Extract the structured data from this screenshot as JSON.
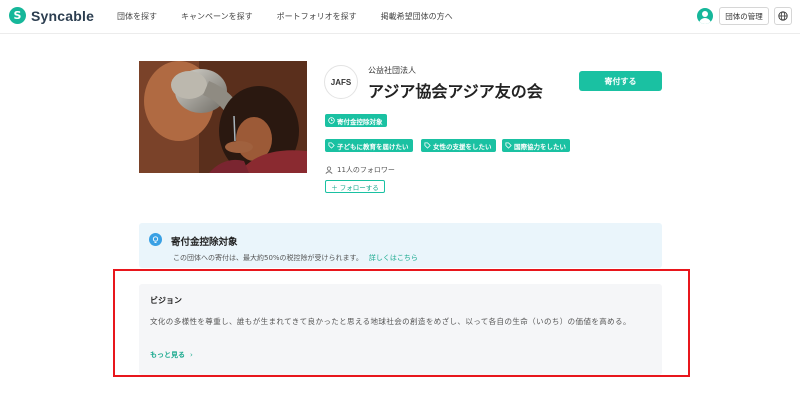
{
  "header": {
    "logo_text": "Syncable",
    "logo_mark": "S",
    "nav": [
      "団体を探す",
      "キャンペーンを探す",
      "ポートフォリオを探す",
      "掲載希望団体の方へ"
    ],
    "manage_label": "団体の管理",
    "brand_color": "#16b79a"
  },
  "org": {
    "type": "公益社団法人",
    "name": "アジア協会アジア友の会",
    "logo_text": "JAFS",
    "donate_label": "寄付する",
    "badge": "寄付金控除対象",
    "tags": [
      "子どもに教育を届けたい",
      "女性の支援をしたい",
      "国際協力をしたい"
    ],
    "followers": "11人のフォロワー",
    "follow_label": "＋ フォローする"
  },
  "tax": {
    "title": "寄付金控除対象",
    "text": "この団体への寄付は、最大約50%の税控除が受けられます。",
    "link": "詳しくはこちら"
  },
  "vision": {
    "title": "ビジョン",
    "text": "文化の多様性を尊重し、誰もが生まれてきて良かったと思える地球社会の創造をめざし、以って各自の生命（いのち）の価値を高める。",
    "more": "もっと見る"
  }
}
